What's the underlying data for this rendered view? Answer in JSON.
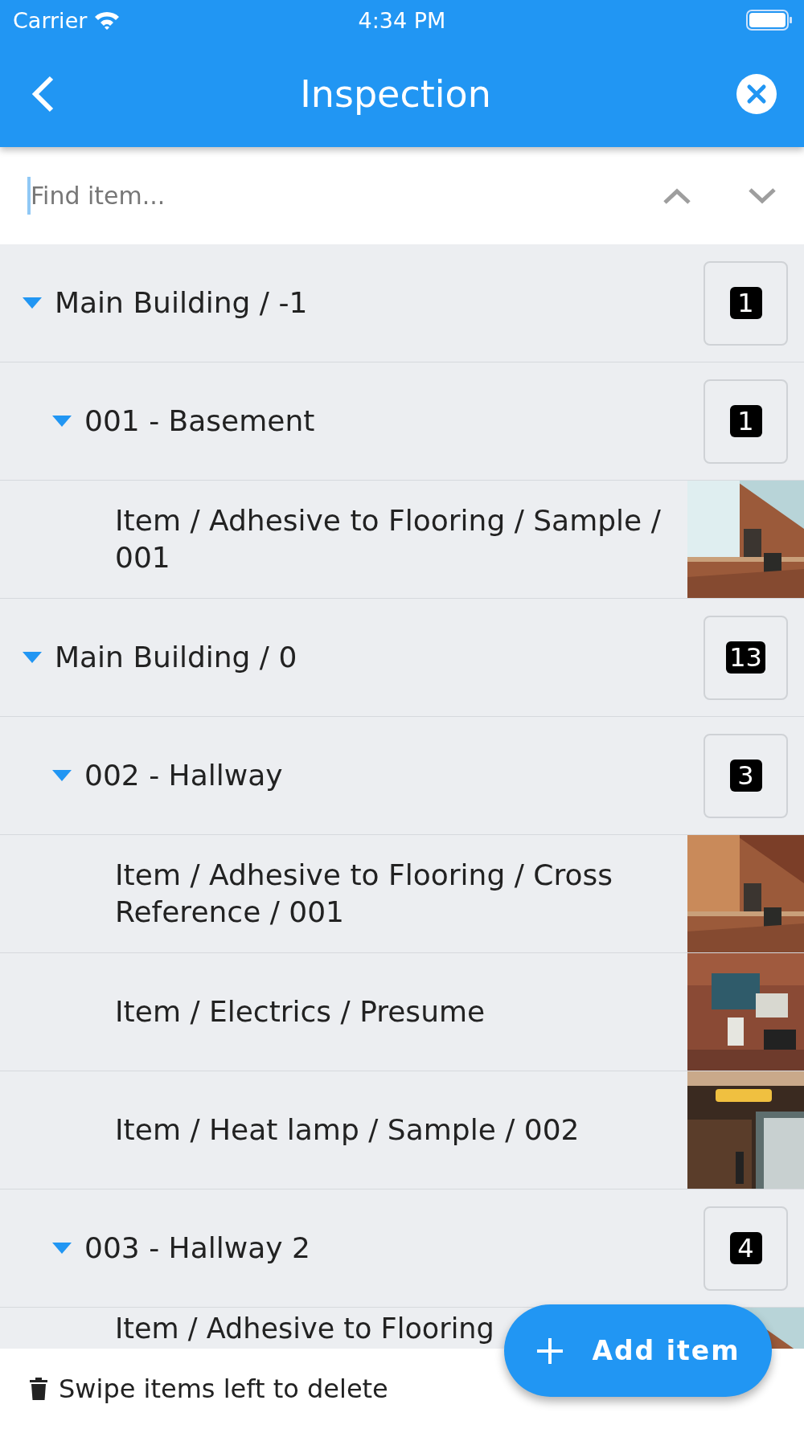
{
  "status_bar": {
    "carrier": "Carrier",
    "time": "4:34 PM"
  },
  "header": {
    "title": "Inspection"
  },
  "search": {
    "placeholder": "Find item..."
  },
  "tree": [
    {
      "kind": "group",
      "label": "Main Building / -1",
      "count": "1",
      "expanded": true,
      "children": [
        {
          "kind": "group",
          "label": "001 - Basement",
          "count": "1",
          "expanded": true,
          "children": [
            {
              "kind": "item",
              "label": "Item / Adhesive to Flooring / Sample / 001"
            }
          ]
        }
      ]
    },
    {
      "kind": "group",
      "label": "Main Building / 0",
      "count": "13",
      "expanded": true,
      "children": [
        {
          "kind": "group",
          "label": "002 - Hallway",
          "count": "3",
          "expanded": true,
          "children": [
            {
              "kind": "item",
              "label": "Item / Adhesive to Flooring / Cross Reference / 001"
            },
            {
              "kind": "item",
              "label": "Item / Electrics / Presume"
            },
            {
              "kind": "item",
              "label": "Item / Heat lamp / Sample / 002"
            }
          ]
        },
        {
          "kind": "group",
          "label": "003 - Hallway 2",
          "count": "4",
          "expanded": true,
          "children": [
            {
              "kind": "item",
              "label": "Item / Adhesive to Flooring"
            }
          ]
        }
      ]
    }
  ],
  "footer": {
    "hint": "Swipe items left to delete"
  },
  "fab": {
    "label": "Add item"
  }
}
